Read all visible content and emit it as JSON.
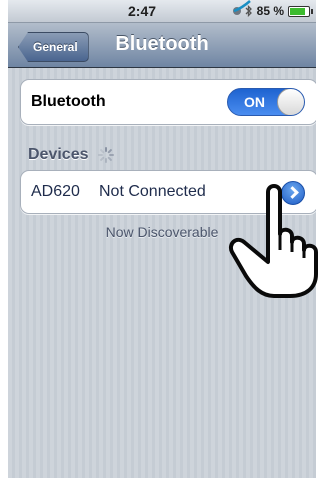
{
  "status_bar": {
    "time": "2:47",
    "battery_percent": "85 %",
    "battery_level": 0.85,
    "icons": [
      "lock-rotation-icon",
      "bluetooth-icon",
      "battery-charging-icon"
    ]
  },
  "nav": {
    "back_label": "General",
    "title": "Bluetooth"
  },
  "bluetooth_row": {
    "label": "Bluetooth",
    "toggle_label": "ON",
    "toggle_on": true
  },
  "devices": {
    "header": "Devices",
    "items": [
      {
        "name": "AD620",
        "status": "Not Connected"
      }
    ],
    "footnote": "Now Discoverable"
  },
  "colors": {
    "toggle_on": "#2f74e0",
    "nav_bar": "#6f85a3",
    "background": "#c5ccd4",
    "accent_disclosure": "#1f5dc6"
  }
}
